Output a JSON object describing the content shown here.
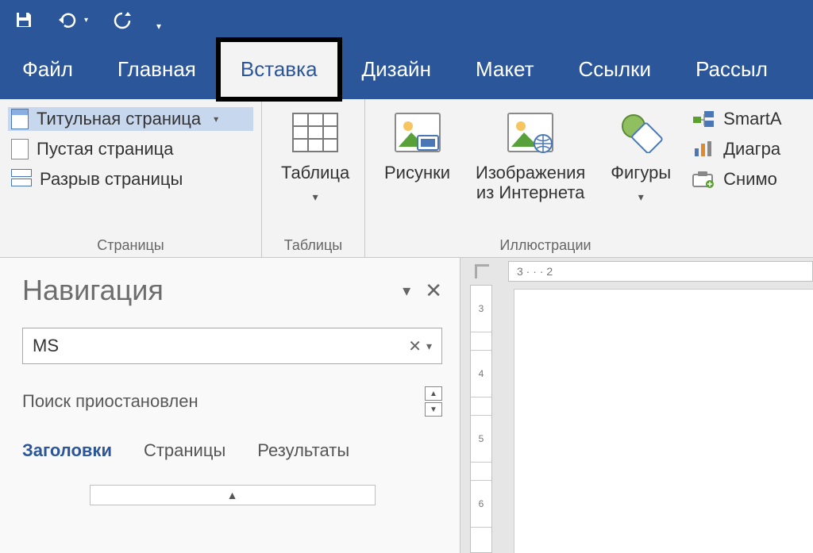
{
  "qat": {
    "save": "save-icon",
    "undo": "undo-icon",
    "redo": "redo-icon"
  },
  "tabs": {
    "file": "Файл",
    "home": "Главная",
    "insert": "Вставка",
    "design": "Дизайн",
    "layout": "Макет",
    "refs": "Ссылки",
    "mail": "Рассыл"
  },
  "ribbon": {
    "pages": {
      "title_page": "Титульная страница",
      "blank_page": "Пустая страница",
      "page_break": "Разрыв страницы",
      "group_label": "Страницы"
    },
    "tables": {
      "table": "Таблица",
      "group_label": "Таблицы"
    },
    "illustrations": {
      "pictures": "Рисунки",
      "online_pictures_l1": "Изображения",
      "online_pictures_l2": "из Интернета",
      "shapes": "Фигуры",
      "group_label": "Иллюстрации",
      "smartart": "SmartA",
      "chart": "Диагра",
      "screenshot": "Снимо"
    }
  },
  "nav": {
    "title": "Навигация",
    "search_value": "MS",
    "search_status": "Поиск приостановлен",
    "tab_headings": "Заголовки",
    "tab_pages": "Страницы",
    "tab_results": "Результаты"
  },
  "hruler_text": "3 · · · 2"
}
